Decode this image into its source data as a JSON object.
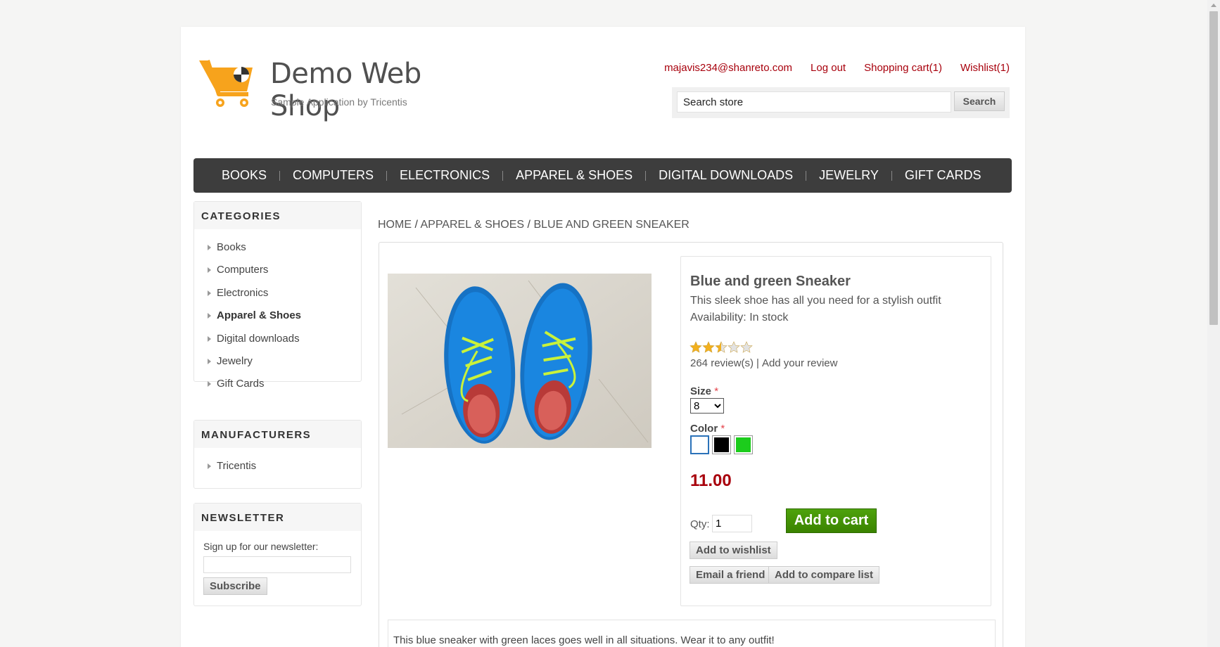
{
  "header": {
    "shop_title": "Demo Web Shop",
    "shop_subtitle": "Sample Application by Tricentis",
    "links": {
      "account": "majavis234@shanreto.com",
      "logout": "Log out",
      "cart": "Shopping cart(1)",
      "wishlist": "Wishlist(1)"
    },
    "search": {
      "placeholder": "Search store",
      "button": "Search"
    }
  },
  "menu": [
    "BOOKS",
    "COMPUTERS",
    "ELECTRONICS",
    "APPAREL & SHOES",
    "DIGITAL DOWNLOADS",
    "JEWELRY",
    "GIFT CARDS"
  ],
  "sidebar": {
    "categories": {
      "title": "CATEGORIES",
      "items": [
        "Books",
        "Computers",
        "Electronics",
        "Apparel & Shoes",
        "Digital downloads",
        "Jewelry",
        "Gift Cards"
      ],
      "active": "Apparel & Shoes"
    },
    "manufacturers": {
      "title": "MANUFACTURERS",
      "items": [
        "Tricentis"
      ]
    },
    "newsletter": {
      "title": "NEWSLETTER",
      "label": "Sign up for our newsletter:",
      "button": "Subscribe"
    }
  },
  "breadcrumb": {
    "home": "HOME",
    "category": "APPAREL & SHOES",
    "current": "BLUE AND GREEN SNEAKER",
    "separator": "/"
  },
  "product": {
    "name": "Blue and green Sneaker",
    "short_description": "This sleek shoe has all you need for a stylish outfit",
    "availability": "Availability: In stock",
    "rating": 2.5,
    "rating_max": 5,
    "reviews": "264 review(s)",
    "review_separator": "|",
    "add_review": "Add your review",
    "size_label": "Size",
    "size_value": "8",
    "required_marker": "*",
    "color_label": "Color",
    "colors": [
      "#ffffff",
      "#000000",
      "#1ccc1c"
    ],
    "selected_color": 0,
    "price": "11.00",
    "qty_label": "Qty:",
    "qty_value": "1",
    "add_to_cart": "Add to cart",
    "add_to_wishlist": "Add to wishlist",
    "email_friend": "Email a friend",
    "add_to_compare": "Add to compare list",
    "full_description": "This blue sneaker with green laces goes well in all situations. Wear it to any outfit!"
  },
  "colors": {
    "link": "#a8000c",
    "menu_bg": "#3d3d3d",
    "cart_button": "#3f8f00",
    "price": "#a8000c",
    "logo": "#f7a31c"
  }
}
